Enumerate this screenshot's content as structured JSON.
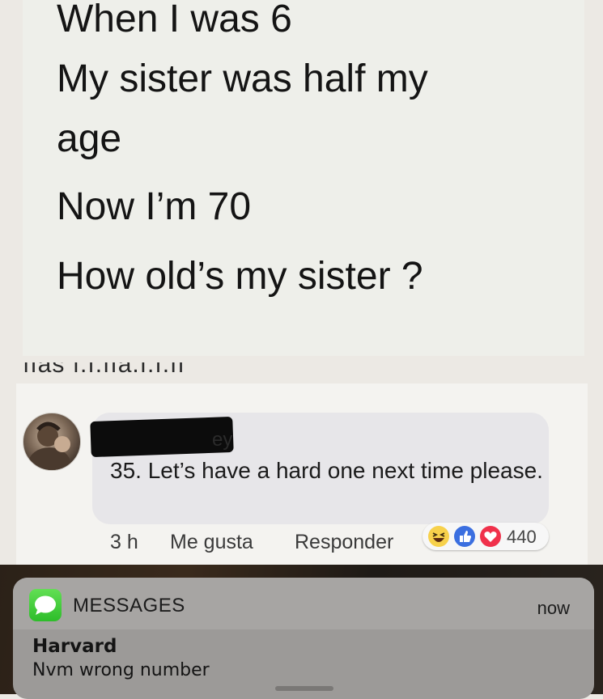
{
  "post": {
    "lines": [
      "When I was 6",
      "My sister was half my",
      "age",
      "Now I’m 70",
      "How old’s my sister ?"
    ],
    "cut_off_text": "ııas ı.ı.ııa.ı.ı.ıı"
  },
  "comment": {
    "author_redacted_fragment": "ey",
    "text": "35. Let’s have a hard one next time please.",
    "time": "3 h",
    "like_label": "Me gusta",
    "reply_label": "Responder",
    "reaction_count": "440",
    "reaction_icons": [
      "haha-icon",
      "like-icon",
      "love-icon"
    ]
  },
  "notification": {
    "app_name": "MESSAGES",
    "time": "now",
    "sender": "Harvard",
    "message": "Nvm wrong number",
    "app_icon": "messages-icon"
  },
  "colors": {
    "card_bg": "#eeefea",
    "bubble_bg": "#e7e6e9",
    "notification_bg": "#9c9a98",
    "like_blue": "#3b6fe0",
    "love_red": "#f0314b",
    "haha_yellow": "#f7d14b",
    "messages_green": "#3fcf3c"
  }
}
